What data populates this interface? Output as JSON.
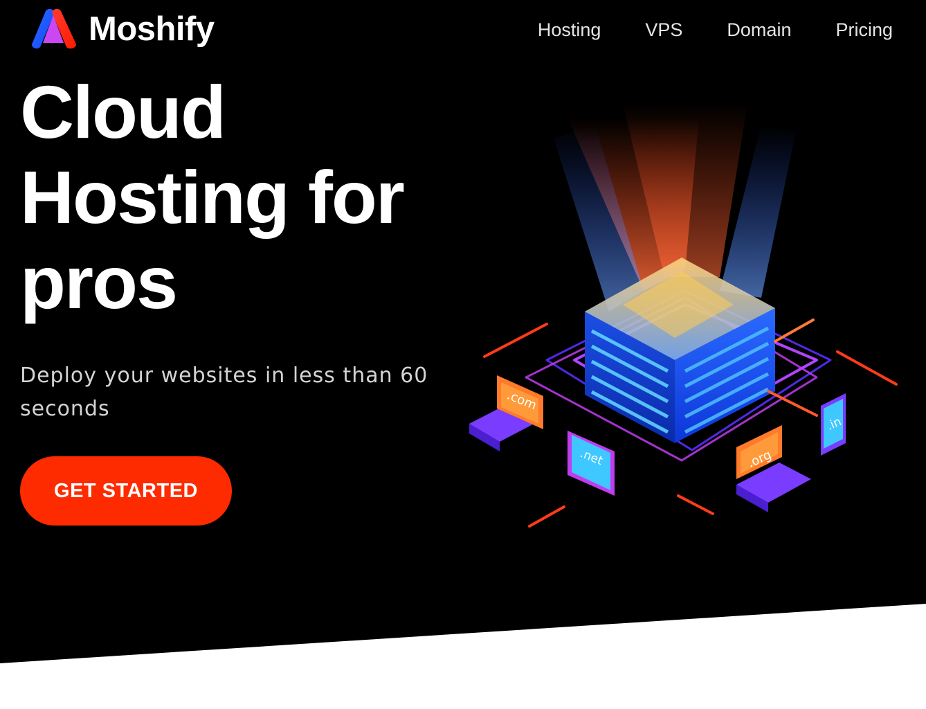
{
  "brand": {
    "name": "Moshify",
    "logo_icon": "moshify-logo-icon"
  },
  "nav": {
    "items": [
      "Hosting",
      "VPS",
      "Domain",
      "Pricing"
    ]
  },
  "hero": {
    "title_lines": [
      "Cloud",
      "Hosting for",
      "pros"
    ],
    "subtitle": "Deploy your websites in less than 60 seconds",
    "cta_label": "GET STARTED"
  },
  "illustration": {
    "domains": [
      ".com",
      ".net",
      ".org",
      ".in"
    ]
  },
  "colors": {
    "background": "#000000",
    "accent": "#ff2b00",
    "server_blue": "#1a4dff",
    "glow_pink": "#c13cf0",
    "text": "#ffffff"
  }
}
